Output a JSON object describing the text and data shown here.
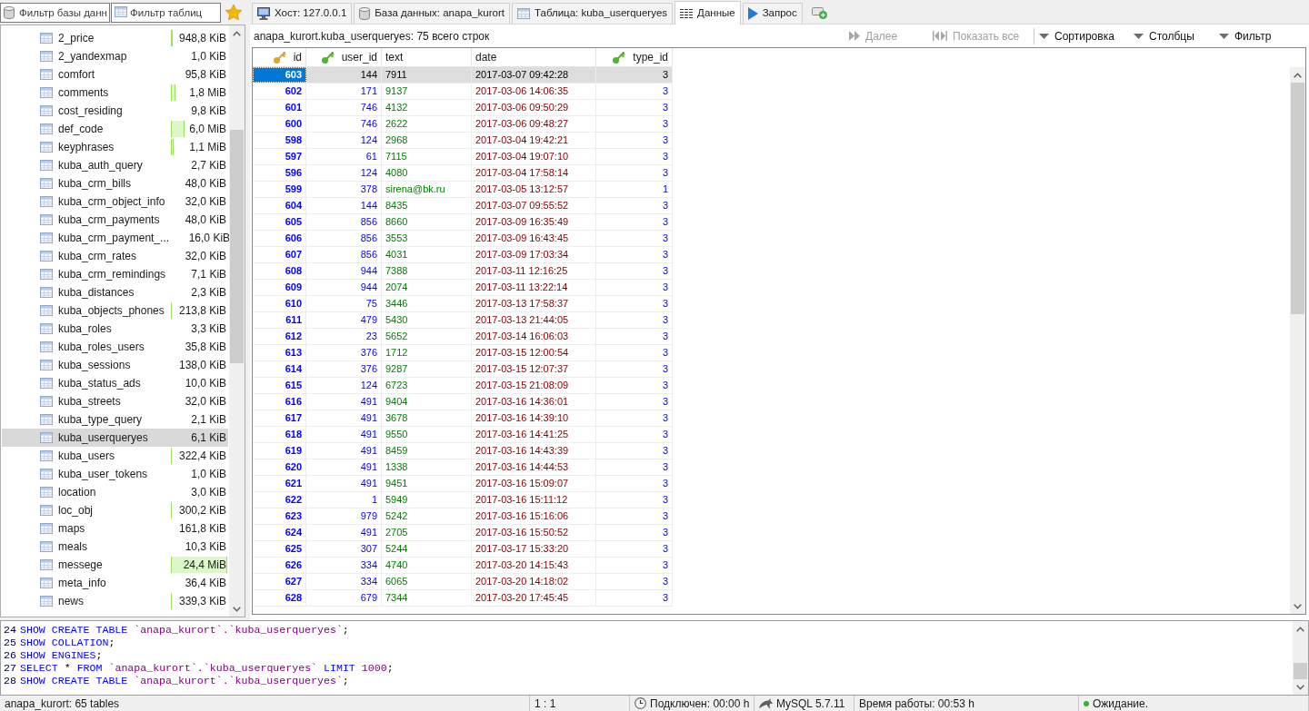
{
  "filters": [
    {
      "kind": "database",
      "placeholder": "Фильтр базы данн"
    },
    {
      "kind": "table",
      "placeholder": "Фильтр таблиц"
    }
  ],
  "tabs": [
    {
      "kind": "host",
      "label": "Хост: 127.0.0.1",
      "selected": false
    },
    {
      "kind": "database",
      "label": "База данных: anapa_kurort",
      "selected": false
    },
    {
      "kind": "table",
      "label": "Таблица: kuba_userqueryes",
      "selected": false
    },
    {
      "kind": "data",
      "label": "Данные",
      "selected": true
    },
    {
      "kind": "query",
      "label": "Запрос",
      "selected": false
    }
  ],
  "sidebar": {
    "items": [
      {
        "name": "2_price",
        "size": "948,8 KiB",
        "selected": false
      },
      {
        "name": "2_yandexmap",
        "size": "1,0 KiB",
        "selected": false
      },
      {
        "name": "comfort",
        "size": "95,8 KiB",
        "selected": false
      },
      {
        "name": "comments",
        "size": "1,8 MiB",
        "selected": false
      },
      {
        "name": "cost_residing",
        "size": "9,8 KiB",
        "selected": false
      },
      {
        "name": "def_code",
        "size": "6,0 MiB",
        "selected": false
      },
      {
        "name": "keyphrases",
        "size": "1,1 MiB",
        "selected": false
      },
      {
        "name": "kuba_auth_query",
        "size": "2,7 KiB",
        "selected": false
      },
      {
        "name": "kuba_crm_bills",
        "size": "48,0 KiB",
        "selected": false
      },
      {
        "name": "kuba_crm_object_info",
        "size": "32,0 KiB",
        "selected": false
      },
      {
        "name": "kuba_crm_payments",
        "size": "48,0 KiB",
        "selected": false
      },
      {
        "name": "kuba_crm_payment_...",
        "size": "16,0 KiB",
        "selected": false
      },
      {
        "name": "kuba_crm_rates",
        "size": "32,0 KiB",
        "selected": false
      },
      {
        "name": "kuba_crm_remindings",
        "size": "7,1 KiB",
        "selected": false
      },
      {
        "name": "kuba_distances",
        "size": "2,3 KiB",
        "selected": false
      },
      {
        "name": "kuba_objects_phones",
        "size": "213,8 KiB",
        "selected": false
      },
      {
        "name": "kuba_roles",
        "size": "3,3 KiB",
        "selected": false
      },
      {
        "name": "kuba_roles_users",
        "size": "35,8 KiB",
        "selected": false
      },
      {
        "name": "kuba_sessions",
        "size": "138,0 KiB",
        "selected": false
      },
      {
        "name": "kuba_status_ads",
        "size": "10,0 KiB",
        "selected": false
      },
      {
        "name": "kuba_streets",
        "size": "32,0 KiB",
        "selected": false
      },
      {
        "name": "kuba_type_query",
        "size": "2,1 KiB",
        "selected": false
      },
      {
        "name": "kuba_userqueryes",
        "size": "6,1 KiB",
        "selected": true
      },
      {
        "name": "kuba_users",
        "size": "322,4 KiB",
        "selected": false
      },
      {
        "name": "kuba_user_tokens",
        "size": "1,0 KiB",
        "selected": false
      },
      {
        "name": "location",
        "size": "3,0 KiB",
        "selected": false
      },
      {
        "name": "loc_obj",
        "size": "300,2 KiB",
        "selected": false
      },
      {
        "name": "maps",
        "size": "161,8 KiB",
        "selected": false
      },
      {
        "name": "meals",
        "size": "10,3 KiB",
        "selected": false
      },
      {
        "name": "messege",
        "size": "24,4 MiB",
        "selected": false
      },
      {
        "name": "meta_info",
        "size": "36,4 KiB",
        "selected": false
      },
      {
        "name": "news",
        "size": "339,3 KiB",
        "selected": false
      }
    ]
  },
  "data_view": {
    "title": "anapa_kurort.kuba_userqueryes: 75 всего строк",
    "toolbar": [
      {
        "kind": "next",
        "label": "Далее",
        "disabled": true
      },
      {
        "kind": "show_all",
        "label": "Показать все",
        "disabled": true
      },
      {
        "kind": "dropdown",
        "label": "Сортировка",
        "disabled": false
      },
      {
        "kind": "dropdown",
        "label": "Столбцы",
        "disabled": false
      },
      {
        "kind": "dropdown",
        "label": "Фильтр",
        "disabled": false
      }
    ],
    "table": {
      "columns": [
        {
          "label": "id",
          "kind": "primary_key"
        },
        {
          "label": "user_id",
          "kind": "foreign_key"
        },
        {
          "label": "text",
          "kind": "text"
        },
        {
          "label": "date",
          "kind": "datetime"
        },
        {
          "label": "type_id",
          "kind": "foreign_key"
        }
      ],
      "rows": [
        {
          "selected": true,
          "cells": [
            "603",
            "144",
            "7911",
            "2017-03-07 09:42:28",
            "3"
          ]
        },
        {
          "selected": false,
          "cells": [
            "602",
            "171",
            "9137",
            "2017-03-06 14:06:35",
            "3"
          ]
        },
        {
          "selected": false,
          "cells": [
            "601",
            "746",
            "4132",
            "2017-03-06 09:50:29",
            "3"
          ]
        },
        {
          "selected": false,
          "cells": [
            "600",
            "746",
            "2622",
            "2017-03-06 09:48:27",
            "3"
          ]
        },
        {
          "selected": false,
          "cells": [
            "598",
            "124",
            "2968",
            "2017-03-04 19:42:21",
            "3"
          ]
        },
        {
          "selected": false,
          "cells": [
            "597",
            "61",
            "7115",
            "2017-03-04 19:07:10",
            "3"
          ]
        },
        {
          "selected": false,
          "cells": [
            "596",
            "124",
            "4080",
            "2017-03-04 17:58:14",
            "3"
          ]
        },
        {
          "selected": false,
          "cells": [
            "599",
            "378",
            "sirena@bk.ru",
            "2017-03-05 13:12:57",
            "1"
          ]
        },
        {
          "selected": false,
          "cells": [
            "604",
            "144",
            "8435",
            "2017-03-07 09:55:52",
            "3"
          ]
        },
        {
          "selected": false,
          "cells": [
            "605",
            "856",
            "8660",
            "2017-03-09 16:35:49",
            "3"
          ]
        },
        {
          "selected": false,
          "cells": [
            "606",
            "856",
            "3553",
            "2017-03-09 16:43:45",
            "3"
          ]
        },
        {
          "selected": false,
          "cells": [
            "607",
            "856",
            "4031",
            "2017-03-09 17:03:34",
            "3"
          ]
        },
        {
          "selected": false,
          "cells": [
            "608",
            "944",
            "7388",
            "2017-03-11 12:16:25",
            "3"
          ]
        },
        {
          "selected": false,
          "cells": [
            "609",
            "944",
            "2074",
            "2017-03-11 13:22:14",
            "3"
          ]
        },
        {
          "selected": false,
          "cells": [
            "610",
            "75",
            "3446",
            "2017-03-13 17:58:37",
            "3"
          ]
        },
        {
          "selected": false,
          "cells": [
            "611",
            "479",
            "5430",
            "2017-03-13 21:44:05",
            "3"
          ]
        },
        {
          "selected": false,
          "cells": [
            "612",
            "23",
            "5652",
            "2017-03-14 16:06:03",
            "3"
          ]
        },
        {
          "selected": false,
          "cells": [
            "613",
            "376",
            "1712",
            "2017-03-15 12:00:54",
            "3"
          ]
        },
        {
          "selected": false,
          "cells": [
            "614",
            "376",
            "9287",
            "2017-03-15 12:07:37",
            "3"
          ]
        },
        {
          "selected": false,
          "cells": [
            "615",
            "124",
            "6723",
            "2017-03-15 21:08:09",
            "3"
          ]
        },
        {
          "selected": false,
          "cells": [
            "616",
            "491",
            "9404",
            "2017-03-16 14:36:01",
            "3"
          ]
        },
        {
          "selected": false,
          "cells": [
            "617",
            "491",
            "3678",
            "2017-03-16 14:39:10",
            "3"
          ]
        },
        {
          "selected": false,
          "cells": [
            "618",
            "491",
            "9550",
            "2017-03-16 14:41:25",
            "3"
          ]
        },
        {
          "selected": false,
          "cells": [
            "619",
            "491",
            "8459",
            "2017-03-16 14:43:39",
            "3"
          ]
        },
        {
          "selected": false,
          "cells": [
            "620",
            "491",
            "1338",
            "2017-03-16 14:44:53",
            "3"
          ]
        },
        {
          "selected": false,
          "cells": [
            "621",
            "491",
            "9451",
            "2017-03-16 15:09:07",
            "3"
          ]
        },
        {
          "selected": false,
          "cells": [
            "622",
            "1",
            "5949",
            "2017-03-16 15:11:12",
            "3"
          ]
        },
        {
          "selected": false,
          "cells": [
            "623",
            "979",
            "5242",
            "2017-03-16 15:16:06",
            "3"
          ]
        },
        {
          "selected": false,
          "cells": [
            "624",
            "491",
            "2705",
            "2017-03-16 15:50:52",
            "3"
          ]
        },
        {
          "selected": false,
          "cells": [
            "625",
            "307",
            "5244",
            "2017-03-17 15:33:20",
            "3"
          ]
        },
        {
          "selected": false,
          "cells": [
            "626",
            "334",
            "4740",
            "2017-03-20 14:15:43",
            "3"
          ]
        },
        {
          "selected": false,
          "cells": [
            "627",
            "334",
            "6065",
            "2017-03-20 14:18:02",
            "3"
          ]
        },
        {
          "selected": false,
          "cells": [
            "628",
            "679",
            "7344",
            "2017-03-20 17:45:45",
            "3"
          ]
        }
      ]
    }
  },
  "sql_log": {
    "lines": [
      {
        "number": "24",
        "tokens": [
          {
            "kind": "keyword",
            "text": "SHOW CREATE TABLE"
          },
          {
            "kind": "identifier",
            "text": "`anapa_kurort`.`kuba_userqueryes`"
          },
          {
            "kind": "punct",
            "text": ";"
          }
        ]
      },
      {
        "number": "25",
        "tokens": [
          {
            "kind": "keyword",
            "text": "SHOW COLLATION"
          },
          {
            "kind": "punct",
            "text": ";"
          }
        ]
      },
      {
        "number": "26",
        "tokens": [
          {
            "kind": "keyword",
            "text": "SHOW ENGINES"
          },
          {
            "kind": "punct",
            "text": ";"
          }
        ]
      },
      {
        "number": "27",
        "tokens": [
          {
            "kind": "keyword",
            "text": "SELECT"
          },
          {
            "kind": "plain",
            "text": "*"
          },
          {
            "kind": "keyword",
            "text": "FROM"
          },
          {
            "kind": "identifier",
            "text": "`anapa_kurort`.`kuba_userqueryes`"
          },
          {
            "kind": "keyword",
            "text": "LIMIT"
          },
          {
            "kind": "number",
            "text": "1000"
          },
          {
            "kind": "punct",
            "text": ";"
          }
        ]
      },
      {
        "number": "28",
        "tokens": [
          {
            "kind": "keyword",
            "text": "SHOW CREATE TABLE"
          },
          {
            "kind": "identifier",
            "text": "`anapa_kurort`.`kuba_userqueryes`"
          },
          {
            "kind": "punct",
            "text": ";"
          }
        ]
      }
    ]
  },
  "status_bar": {
    "items": [
      {
        "kind": "plain",
        "text": "anapa_kurort: 65 tables"
      },
      {
        "kind": "plain",
        "text": "1 : 1"
      },
      {
        "kind": "connected",
        "text": "Подключен: 00:00 h"
      },
      {
        "kind": "server",
        "text": "MySQL 5.7.11"
      },
      {
        "kind": "uptime",
        "text": "Время работы: 00:53 h"
      },
      {
        "kind": "status",
        "text": "Ожидание."
      }
    ]
  }
}
